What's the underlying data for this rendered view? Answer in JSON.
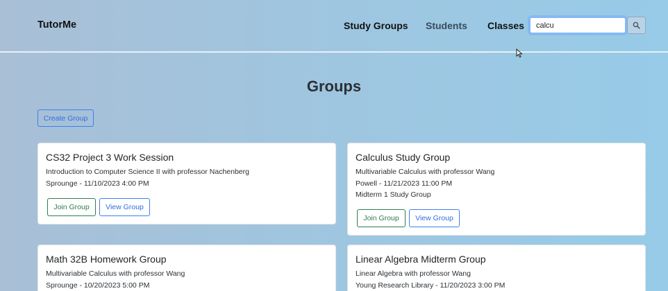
{
  "nav": {
    "brand": "TutorMe",
    "links": [
      "Study Groups",
      "Students",
      "Classes"
    ],
    "search_value": "calcu"
  },
  "page": {
    "title": "Groups",
    "create_label": "Create Group"
  },
  "cards": [
    {
      "title": "CS32 Project 3 Work Session",
      "course": "Introduction to Computer Science II with professor Nachenberg",
      "location_time": "Sprounge - 11/10/2023 4:00 PM",
      "join_label": "Join Group",
      "view_label": "View Group"
    },
    {
      "title": "Calculus Study Group",
      "course": "Multivariable Calculus with professor Wang",
      "location_time": "Powell - 11/21/2023 11:00 PM",
      "note": "Midterm 1 Study Group",
      "join_label": "Join Group",
      "view_label": "View Group"
    },
    {
      "title": "Math 32B Homework Group",
      "course": "Multivariable Calculus with professor Wang",
      "location_time": "Sprounge - 10/20/2023 5:00 PM"
    },
    {
      "title": "Linear Algebra Midterm Group",
      "course": "Linear Algebra with professor Wang",
      "location_time": "Young Research Library - 11/20/2023 3:00 PM"
    }
  ],
  "colors": {
    "primary": "#2f6ee0",
    "success": "#2e7d4f",
    "search_focus": "#86b7fe"
  }
}
